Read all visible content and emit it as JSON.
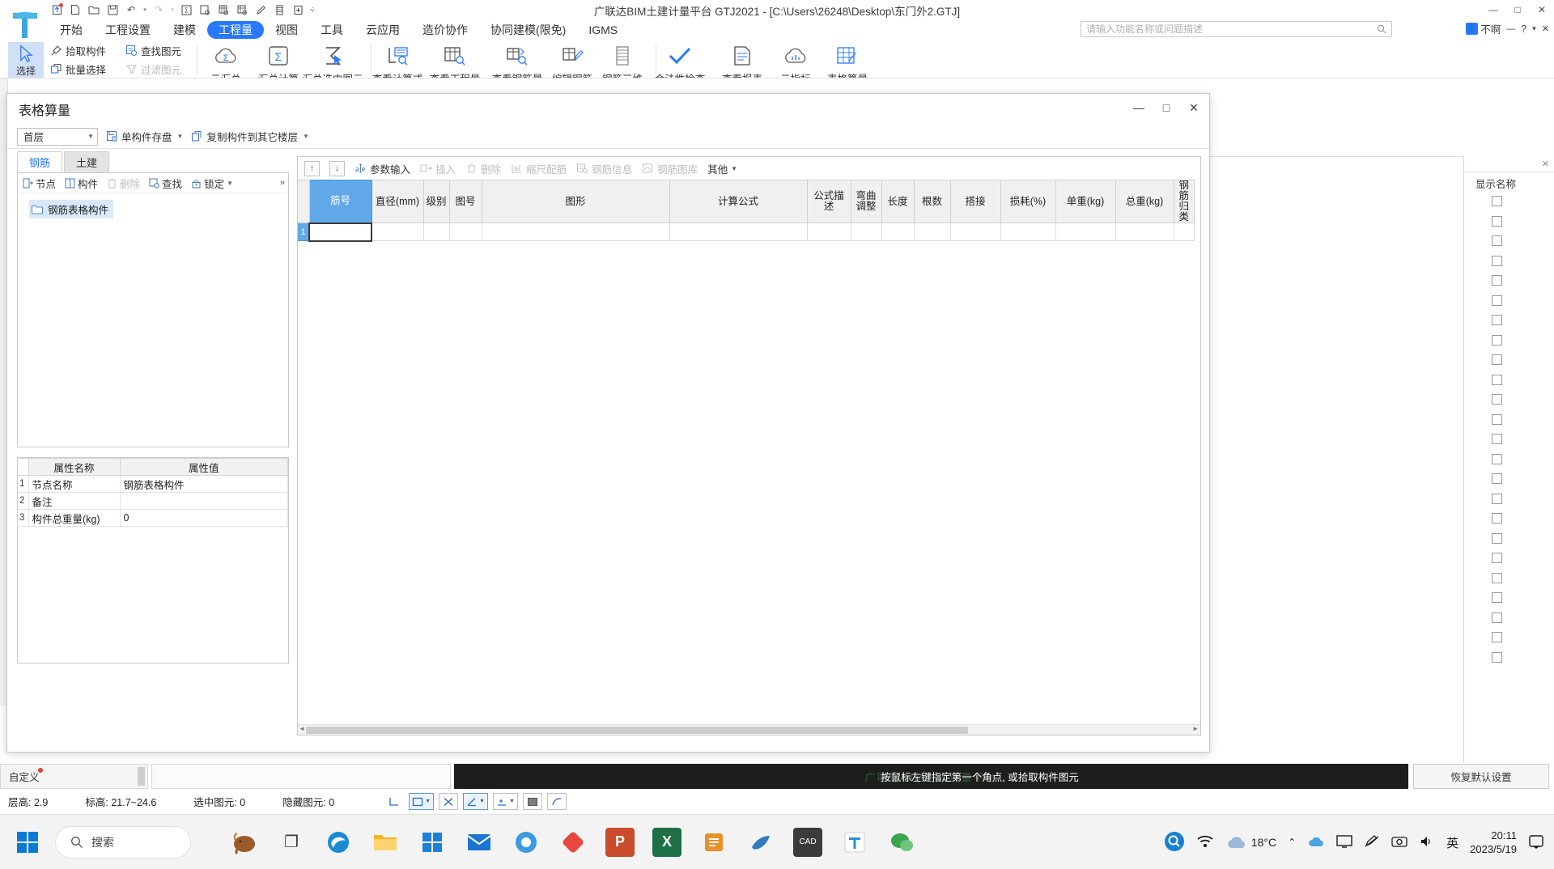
{
  "window": {
    "title": "广联达BIM土建计量平台 GTJ2021 - [C:\\Users\\26248\\Desktop\\东门外2.GTJ]",
    "minimize": "—",
    "maximize": "□",
    "close": "✕"
  },
  "quick_access": [
    {
      "name": "upload-icon",
      "glyph": "⬆"
    },
    {
      "name": "new-file-icon",
      "glyph": "🗋"
    },
    {
      "name": "open-folder-icon",
      "glyph": "🗁"
    },
    {
      "name": "save-icon",
      "glyph": "🖫"
    },
    {
      "name": "undo-icon",
      "glyph": "↶"
    },
    {
      "name": "redo-icon",
      "glyph": "↷"
    },
    {
      "name": "sum-icon",
      "glyph": "Σ"
    },
    {
      "name": "report-search-icon",
      "glyph": "▤"
    },
    {
      "name": "grid-search-icon",
      "glyph": "▦"
    },
    {
      "name": "grid-check-icon",
      "glyph": "▩"
    },
    {
      "name": "pen-icon",
      "glyph": "✎"
    },
    {
      "name": "ruler-icon",
      "glyph": "▥"
    },
    {
      "name": "add-box-icon",
      "glyph": "⊞"
    },
    {
      "name": "more-icon",
      "glyph": "⋮"
    }
  ],
  "menu": {
    "items": [
      {
        "label": "开始",
        "active": false
      },
      {
        "label": "工程设置",
        "active": false
      },
      {
        "label": "建模",
        "active": false
      },
      {
        "label": "工程量",
        "active": true
      },
      {
        "label": "视图",
        "active": false
      },
      {
        "label": "工具",
        "active": false
      },
      {
        "label": "云应用",
        "active": false
      },
      {
        "label": "造价协作",
        "active": false
      },
      {
        "label": "协同建模(限免)",
        "active": false
      },
      {
        "label": "IGMS",
        "active": false
      }
    ],
    "search_placeholder": "请输入功能名称或问题描述",
    "user_label": "不啊",
    "right_icons": [
      "minimize",
      "help",
      "chevron-down",
      "close"
    ]
  },
  "ribbon": {
    "select_label": "选择",
    "group1": [
      {
        "label": "拾取构件",
        "icon": "pick-icon",
        "disabled": false
      },
      {
        "label": "批量选择",
        "icon": "batch-select-icon",
        "disabled": false
      }
    ],
    "group2": [
      {
        "label": "查找图元",
        "icon": "find-element-icon",
        "disabled": false
      },
      {
        "label": "过滤图元",
        "icon": "filter-element-icon",
        "disabled": true
      }
    ],
    "buttons": [
      {
        "label": "云汇总",
        "icon": "cloud-sum-icon"
      },
      {
        "label": "汇总计算",
        "icon": "sum-calc-icon"
      },
      {
        "label": "汇总选中图元",
        "icon": "sum-selected-icon"
      },
      {
        "label": "查看计算式",
        "icon": "view-formula-icon"
      },
      {
        "label": "查看工程量",
        "icon": "view-quantity-icon"
      },
      {
        "label": "查看钢筋量",
        "icon": "view-rebar-icon"
      },
      {
        "label": "编辑钢筋",
        "icon": "edit-rebar-icon"
      },
      {
        "label": "钢筋三维",
        "icon": "rebar-3d-icon"
      },
      {
        "label": "合法性检查",
        "icon": "validate-icon"
      },
      {
        "label": "查看报表",
        "icon": "view-report-icon"
      },
      {
        "label": "云指标",
        "icon": "cloud-index-icon"
      },
      {
        "label": "表格算量",
        "icon": "table-calc-icon"
      }
    ]
  },
  "dialog": {
    "title": "表格算量",
    "min_label": "—",
    "max_label": "□",
    "close_label": "✕",
    "toolbar": {
      "floor_value": "首层",
      "save_component_label": "单构件存盘",
      "copy_component_label": "复制构件到其它楼层"
    },
    "tabs": [
      {
        "label": "钢筋",
        "active": true
      },
      {
        "label": "土建",
        "active": false
      }
    ],
    "left_toolbar": [
      {
        "label": "节点",
        "icon": "node-add-icon",
        "disabled": false
      },
      {
        "label": "构件",
        "icon": "component-icon",
        "disabled": false
      },
      {
        "label": "删除",
        "icon": "trash-icon",
        "disabled": true
      },
      {
        "label": "查找",
        "icon": "find-icon",
        "disabled": false
      },
      {
        "label": "锁定",
        "icon": "lock-icon",
        "disabled": false
      }
    ],
    "tree": [
      {
        "label": "钢筋表格构件",
        "icon": "folder-icon",
        "selected": true
      }
    ],
    "properties": {
      "headers": [
        "属性名称",
        "属性值"
      ],
      "rows": [
        {
          "no": "1",
          "name": "节点名称",
          "value": "钢筋表格构件"
        },
        {
          "no": "2",
          "name": "备注",
          "value": ""
        },
        {
          "no": "3",
          "name": "构件总重量(kg)",
          "value": "0"
        }
      ]
    },
    "grid_toolbar": [
      {
        "label": "",
        "icon": "move-up-icon",
        "disabled": false,
        "type": "square"
      },
      {
        "label": "",
        "icon": "move-down-icon",
        "disabled": false,
        "type": "square"
      },
      {
        "label": "参数输入",
        "icon": "param-input-icon",
        "disabled": false
      },
      {
        "label": "插入",
        "icon": "insert-icon",
        "disabled": true
      },
      {
        "label": "删除",
        "icon": "trash-icon",
        "disabled": true
      },
      {
        "label": "缩尺配筋",
        "icon": "scale-rebar-icon",
        "disabled": true
      },
      {
        "label": "钢筋信息",
        "icon": "rebar-info-icon",
        "disabled": true
      },
      {
        "label": "钢筋图库",
        "icon": "rebar-library-icon",
        "disabled": true
      },
      {
        "label": "其他",
        "icon": "chevron-down-icon",
        "disabled": false
      }
    ],
    "grid": {
      "headers": [
        "筋号",
        "直径(mm)",
        "级别",
        "图号",
        "图形",
        "计算公式",
        "公式描述",
        "弯曲调整",
        "长度",
        "根数",
        "搭接",
        "损耗(%)",
        "单重(kg)",
        "总重(kg)",
        "钢筋归类"
      ],
      "selected_header": "筋号",
      "rows": [
        {
          "no": "1",
          "cells": [
            "",
            "",
            "",
            "",
            "",
            "",
            "",
            "",
            "",
            "",
            "",
            "",
            "",
            ""
          ]
        }
      ]
    }
  },
  "right_panel": {
    "title": "显示名称",
    "checkbox_count": 24,
    "close_label": "✕"
  },
  "bottom": {
    "custom_label": "自定义",
    "command_hint": "按鼠标左键指定第一个角点, 或拾取构件图元",
    "reset_label": "恢复默认设置",
    "status": [
      {
        "label": "层高:",
        "value": "2.9"
      },
      {
        "label": "标高:",
        "value": "21.7~24.6"
      },
      {
        "label": "选中图元:",
        "value": "0"
      },
      {
        "label": "隐藏图元:",
        "value": "0"
      }
    ],
    "draw_tools": [
      "corner-icon",
      "rect-icon",
      "x-icon",
      "angle-icon",
      "plus-icon",
      "image-icon",
      "arc-icon"
    ]
  },
  "taskbar": {
    "search_placeholder": "搜索",
    "apps": [
      {
        "name": "task-view-icon",
        "glyph": "❐",
        "color": "#4a4a4a"
      },
      {
        "name": "edge-icon",
        "glyph": "e",
        "color": "#1b8ad4"
      },
      {
        "name": "file-explorer-icon",
        "glyph": "🗀",
        "color": "#f5b71d"
      },
      {
        "name": "store-icon",
        "glyph": "▦",
        "color": "#1e7fd4"
      },
      {
        "name": "mail-icon",
        "glyph": "✉",
        "color": "#1876d2"
      },
      {
        "name": "browser-icon",
        "glyph": "◉",
        "color": "#3b9ae1"
      },
      {
        "name": "diamond-app-icon",
        "glyph": "◆",
        "color": "#e8473f"
      },
      {
        "name": "powerpoint-icon",
        "glyph": "P",
        "color": "#c94b2c"
      },
      {
        "name": "excel-icon",
        "glyph": "X",
        "color": "#1d7044"
      },
      {
        "name": "notes-icon",
        "glyph": "▤",
        "color": "#e8902a"
      },
      {
        "name": "dolphin-icon",
        "glyph": "🐬",
        "color": "#2f7bbd"
      },
      {
        "name": "cad-icon",
        "glyph": "CAD",
        "color": "#3b3b3b"
      },
      {
        "name": "gtj-icon",
        "glyph": "T",
        "color": "#2e8fd8"
      },
      {
        "name": "wechat-icon",
        "glyph": "💬",
        "color": "#3aa64c"
      }
    ],
    "temperature": "18°C",
    "time": "20:11",
    "date": "2023/5/19",
    "ime_label": "英"
  }
}
